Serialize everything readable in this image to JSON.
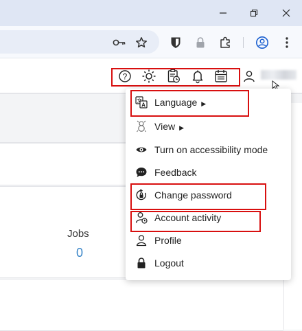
{
  "browser": {
    "window_controls": [
      {
        "name": "minimize",
        "symbol": "—"
      },
      {
        "name": "restore",
        "symbol": "❐"
      },
      {
        "name": "close",
        "symbol": "✕"
      }
    ],
    "toolbar_icons": [
      "key-icon",
      "bookmark-star-icon",
      "bitwarden-icon",
      "lock-icon",
      "extensions-icon",
      "profile-icon",
      "kebab-menu-icon"
    ]
  },
  "header_icons": [
    "help-icon",
    "theme-icon",
    "clipboard-clock-icon",
    "notifications-bell-icon",
    "calendar-icon",
    "user-icon"
  ],
  "dashboard": {
    "jobs_label": "Jobs",
    "jobs_value": "0"
  },
  "user_menu": {
    "items": [
      {
        "label": "Language",
        "icon": "language-icon",
        "submenu": true
      },
      {
        "label": "View",
        "icon": "view-icon",
        "submenu": true
      },
      {
        "label": "Turn on accessibility mode",
        "icon": "eye-icon",
        "submenu": false
      },
      {
        "label": "Feedback",
        "icon": "feedback-icon",
        "submenu": false
      },
      {
        "label": "Change password",
        "icon": "change-password-icon",
        "submenu": false
      },
      {
        "label": "Account activity",
        "icon": "account-activity-icon",
        "submenu": false
      },
      {
        "label": "Profile",
        "icon": "profile-icon",
        "submenu": false
      },
      {
        "label": "Logout",
        "icon": "logout-lock-icon",
        "submenu": false
      }
    ],
    "submenu_arrow": "▶"
  },
  "colors": {
    "highlight": "#d80f0f",
    "link_value": "#3a86c8",
    "titlebar": "#dfe6f4"
  }
}
